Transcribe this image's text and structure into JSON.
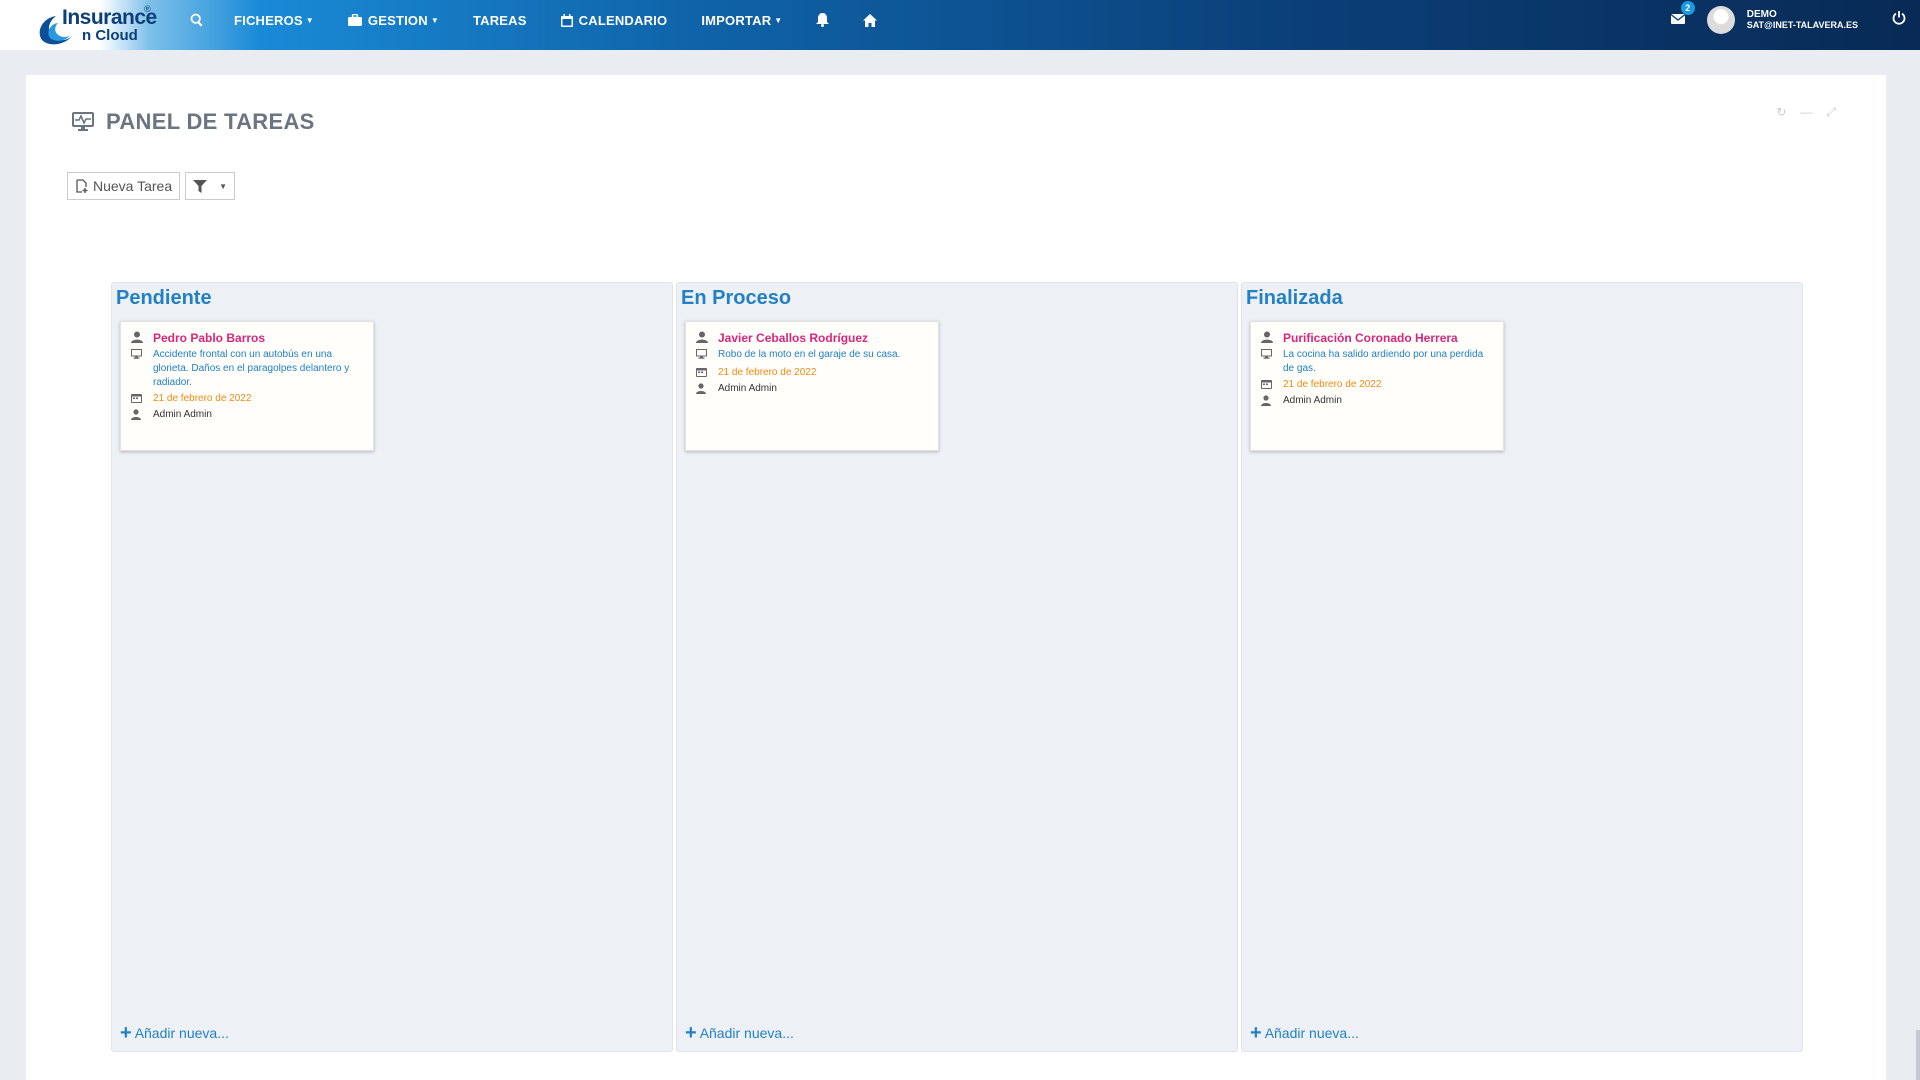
{
  "brand": {
    "logo_line1": "Insurance",
    "logo_line2": "n Cloud",
    "logo_reg": "®"
  },
  "nav": {
    "items": [
      {
        "label": "FICHEROS",
        "caret": "▼"
      },
      {
        "label": "GESTION",
        "caret": "▼"
      },
      {
        "label": "TAREAS"
      },
      {
        "label": "CALENDARIO"
      },
      {
        "label": "IMPORTAR",
        "caret": "▼"
      }
    ],
    "mail_count": "2",
    "user_name": "DEMO",
    "user_org": "SAT@INET-TALAVERA.ES"
  },
  "panel": {
    "title": "PANEL DE TAREAS",
    "new_task_label": "Nueva Tarea",
    "filter_caret": "▼"
  },
  "columns": [
    {
      "title": "Pendiente",
      "add_label": "Añadir nueva...",
      "cards": [
        {
          "name": "Pedro Pablo Barros",
          "description": "Accidente frontal con un autobús en una glorieta. Daños en el paragolpes delantero y radiador.",
          "date": "21 de febrero de 2022",
          "assignee": "Admin Admin"
        }
      ]
    },
    {
      "title": "En Proceso",
      "add_label": "Añadir nueva...",
      "cards": [
        {
          "name": "Javier Ceballos Rodríguez",
          "description": "Robo de la moto en el garaje de su casa.",
          "date": "21 de febrero de 2022",
          "assignee": "Admin Admin"
        }
      ]
    },
    {
      "title": "Finalizada",
      "add_label": "Añadir nueva...",
      "cards": [
        {
          "name": "Purificación Coronado Herrera",
          "description": "La cocina ha salido ardiendo por una perdida de gas.",
          "date": "21 de febrero de 2022",
          "assignee": "Admin Admin"
        }
      ]
    }
  ],
  "colors": {
    "accent": "#2380c4",
    "name": "#d8267b",
    "date": "#ef8b12",
    "nav_dark": "#082a55"
  }
}
